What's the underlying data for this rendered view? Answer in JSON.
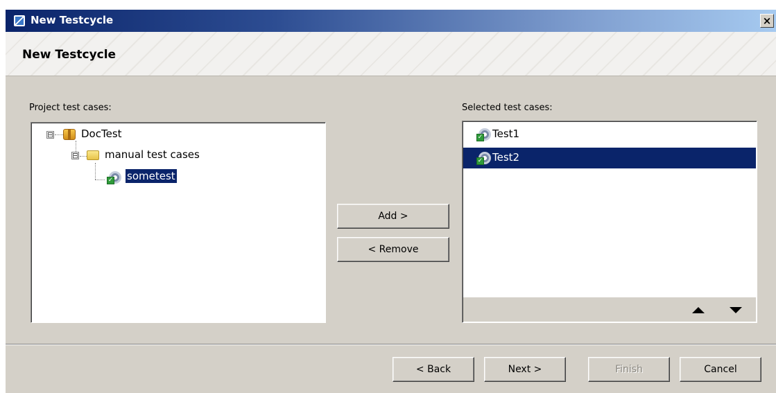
{
  "window": {
    "title": "New Testcycle",
    "close_glyph": "×",
    "app_icon": "app-icon"
  },
  "header": {
    "title": "New Testcycle"
  },
  "left_panel": {
    "label": "Project test cases:",
    "tree": {
      "root": {
        "label": "DocTest",
        "icon": "package-icon",
        "expander": "⊟"
      },
      "folder": {
        "label": "manual test cases",
        "icon": "folder-icon",
        "expander": "⊟"
      },
      "leaf": {
        "label": "sometest",
        "icon": "gear-check-icon",
        "selected": true
      }
    }
  },
  "middle": {
    "add_label": "Add >",
    "remove_label": "< Remove"
  },
  "right_panel": {
    "label": "Selected test cases:",
    "items": [
      {
        "label": "Test1",
        "icon": "gear-check-icon",
        "selected": false
      },
      {
        "label": "Test2",
        "icon": "gear-check-icon",
        "selected": true
      }
    ]
  },
  "footer": {
    "back_label": "< Back",
    "next_label": "Next >",
    "finish_label": "Finish",
    "cancel_label": "Cancel",
    "finish_enabled": false
  },
  "colors": {
    "titlebar_start": "#0a246a",
    "titlebar_end": "#a6caf0",
    "selection": "#0a246a",
    "dialog_bg": "#d4d0c8"
  }
}
